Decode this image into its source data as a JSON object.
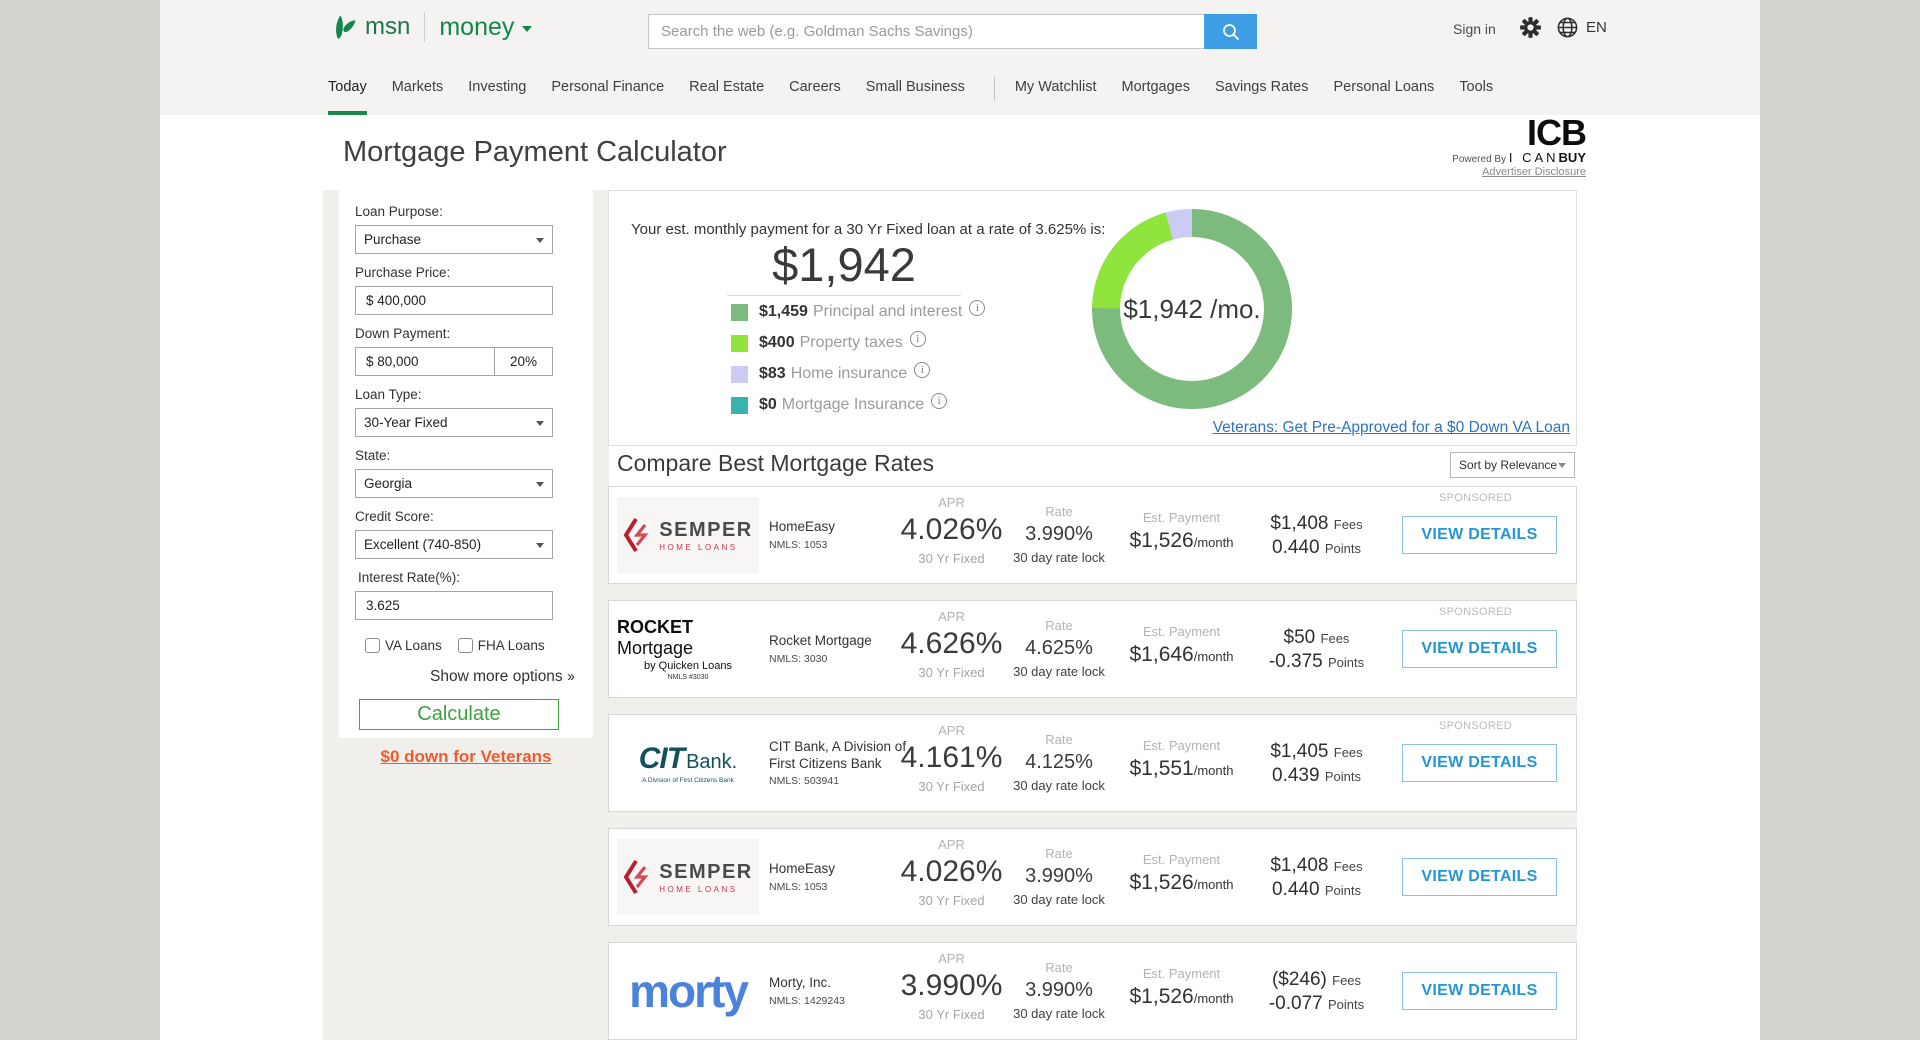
{
  "header": {
    "brand": "msn",
    "vertical": "money",
    "search_placeholder": "Search the web (e.g. Goldman Sachs Savings)",
    "sign_in": "Sign in",
    "lang": "EN"
  },
  "nav": {
    "items": [
      {
        "label": "Today",
        "active": true
      },
      {
        "label": "Markets"
      },
      {
        "label": "Investing"
      },
      {
        "label": "Personal Finance"
      },
      {
        "label": "Real Estate"
      },
      {
        "label": "Careers"
      },
      {
        "label": "Small Business"
      },
      {
        "label": "My Watchlist",
        "divider_before": true
      },
      {
        "label": "Mortgages"
      },
      {
        "label": "Savings Rates"
      },
      {
        "label": "Personal Loans"
      },
      {
        "label": "Tools"
      }
    ]
  },
  "page": {
    "title": "Mortgage Payment Calculator",
    "icb_big": "ICB",
    "powered_by": "Powered By",
    "brand_ican": "I CAN",
    "brand_buy": "BUY",
    "advertiser": "Advertiser Disclosure"
  },
  "form": {
    "loan_purpose": {
      "label": "Loan Purpose:",
      "value": "Purchase"
    },
    "purchase_price": {
      "label": "Purchase Price:",
      "value": "$ 400,000"
    },
    "down_payment": {
      "label": "Down Payment:",
      "value": "$ 80,000",
      "pct": "20%"
    },
    "loan_type": {
      "label": "Loan Type:",
      "value": "30-Year Fixed"
    },
    "state": {
      "label": "State:",
      "value": "Georgia"
    },
    "credit_score": {
      "label": "Credit Score:",
      "value": "Excellent (740-850)"
    },
    "interest_rate": {
      "label": "Interest Rate(%):",
      "value": "3.625"
    },
    "checkboxes": [
      "VA Loans",
      "FHA Loans"
    ],
    "show_more": "Show more options",
    "calculate": "Calculate",
    "vet_link": "$0 down for Veterans"
  },
  "summary": {
    "intro": "Your est. monthly payment for a 30 Yr Fixed loan at a rate of 3.625% is:",
    "total": "$1,942",
    "donut_label": "$1,942 /mo.",
    "va_link": "Veterans: Get Pre-Approved for a $0 Down VA Loan"
  },
  "chart_data": {
    "type": "pie",
    "title": "Monthly payment breakdown",
    "labels": [
      "Principal and interest",
      "Property taxes",
      "Home insurance",
      "Mortgage Insurance"
    ],
    "values": [
      1459,
      400,
      83,
      0
    ],
    "amounts": [
      "$1,459",
      "$400",
      "$83",
      "$0"
    ],
    "colors": [
      "#7cba7d",
      "#8fe43d",
      "#cbcbf4",
      "#39b3ab"
    ],
    "center_label": "$1,942 /mo."
  },
  "compare": {
    "title": "Compare Best Mortgage Rates",
    "sort": "Sort by Relevance",
    "columns": {
      "sponsored": "SPONSORED",
      "apr": "APR",
      "term": "30 Yr Fixed",
      "rate": "Rate",
      "lock": "30 day rate lock",
      "est": "Est. Payment",
      "per": "/month",
      "fees": "Fees",
      "points": "Points",
      "cta": "VIEW DETAILS"
    },
    "rows": [
      {
        "sponsored": true,
        "logo": {
          "type": "semper",
          "name": "SEMPER",
          "sub": "HOME LOANS"
        },
        "name": "HomeEasy",
        "nmls": "NMLS: 1053",
        "apr": "4.026%",
        "rate": "3.990%",
        "payment": "$1,526",
        "fees": "$1,408",
        "points": "0.440"
      },
      {
        "sponsored": true,
        "logo": {
          "type": "rocket",
          "l1a": "ROCKET",
          "l1b": " Mortgage",
          "l2": "by Quicken Loans",
          "l3": "NMLS #3030"
        },
        "name": "Rocket Mortgage",
        "nmls": "NMLS: 3030",
        "apr": "4.626%",
        "rate": "4.625%",
        "payment": "$1,646",
        "fees": "$50",
        "points": "-0.375"
      },
      {
        "sponsored": true,
        "logo": {
          "type": "cit",
          "main": "CIT",
          "bank": "Bank.",
          "sub": "A Division of First Citizens Bank"
        },
        "name": "CIT Bank, A Division of First Citizens Bank",
        "nmls": "NMLS: 503941",
        "apr": "4.161%",
        "rate": "4.125%",
        "payment": "$1,551",
        "fees": "$1,405",
        "points": "0.439"
      },
      {
        "sponsored": false,
        "logo": {
          "type": "semper",
          "name": "SEMPER",
          "sub": "HOME LOANS"
        },
        "name": "HomeEasy",
        "nmls": "NMLS: 1053",
        "apr": "4.026%",
        "rate": "3.990%",
        "payment": "$1,526",
        "fees": "$1,408",
        "points": "0.440"
      },
      {
        "sponsored": false,
        "logo": {
          "type": "morty",
          "name": "morty"
        },
        "name": "Morty, Inc.",
        "nmls": "NMLS: 1429243",
        "apr": "3.990%",
        "rate": "3.990%",
        "payment": "$1,526",
        "fees": "($246)",
        "points": "-0.077"
      }
    ]
  }
}
